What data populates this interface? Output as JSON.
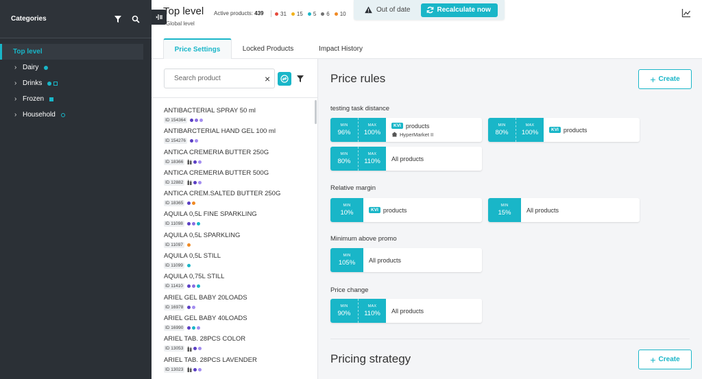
{
  "sidebar": {
    "title": "Categories",
    "items": [
      {
        "label": "Top level",
        "marker": ""
      },
      {
        "label": "Dairy",
        "marker": "dot"
      },
      {
        "label": "Drinks",
        "marker": "dot+square-outline"
      },
      {
        "label": "Frozen",
        "marker": "square"
      },
      {
        "label": "Household",
        "marker": "ring"
      }
    ]
  },
  "header": {
    "title": "Top level",
    "subtitle": "Global level",
    "active_label": "Active products:",
    "active_count": "439",
    "counts": [
      {
        "value": "31",
        "color": "#e64a3b"
      },
      {
        "value": "15",
        "color": "#f2b21b"
      },
      {
        "value": "5",
        "color": "#19b6c8"
      },
      {
        "value": "6",
        "color": "#707070"
      },
      {
        "value": "10",
        "color": "#f08a24"
      }
    ]
  },
  "banner": {
    "status": "Out of date",
    "button": "Recalculate now"
  },
  "tabs": [
    {
      "label": "Price Settings",
      "active": true
    },
    {
      "label": "Locked Products",
      "active": false
    },
    {
      "label": "Impact History",
      "active": false
    }
  ],
  "search": {
    "placeholder": "Search product",
    "value": ""
  },
  "products": [
    {
      "name": "ANTIBACTERIAL SPRAY 50 ml",
      "id": "ID 154364",
      "icons": [
        "purple",
        "violet",
        "light-violet"
      ]
    },
    {
      "name": "ANTIBARCTERIAL HAND GEL 100 ml",
      "id": "ID 154276",
      "icons": [
        "purple",
        "light-violet"
      ]
    },
    {
      "name": "ANTICA CREMERIA BUTTER 250G",
      "id": "ID 18366",
      "icons": [
        "bottle",
        "purple",
        "light-violet"
      ]
    },
    {
      "name": "ANTICA CREMERIA BUTTER 500G",
      "id": "ID 12882",
      "icons": [
        "bottle",
        "purple",
        "light-violet"
      ]
    },
    {
      "name": "ANTICA CREM.SALTED BUTTER 250G",
      "id": "ID 18365",
      "icons": [
        "purple",
        "orange"
      ]
    },
    {
      "name": "AQUILA 0,5L FINE SPARKLING",
      "id": "ID 11098",
      "icons": [
        "purple",
        "violet",
        "teal"
      ]
    },
    {
      "name": "AQUILA 0,5L SPARKLING",
      "id": "ID 11097",
      "icons": [
        "orange"
      ]
    },
    {
      "name": "AQUILA 0,5L STILL",
      "id": "ID 11099",
      "icons": [
        "teal"
      ]
    },
    {
      "name": "AQUILA 0,75L STILL",
      "id": "ID 11410",
      "icons": [
        "purple",
        "violet",
        "teal"
      ]
    },
    {
      "name": "ARIEL GEL BABY 20LOADS",
      "id": "ID 16978",
      "icons": [
        "purple",
        "light-violet"
      ]
    },
    {
      "name": "ARIEL GEL BABY 40LOADS",
      "id": "ID 16990",
      "icons": [
        "purple",
        "teal",
        "light-violet"
      ]
    },
    {
      "name": "ARIEL TAB. 28PCS COLOR",
      "id": "ID 13053",
      "icons": [
        "bottle",
        "purple",
        "light-violet"
      ]
    },
    {
      "name": "ARIEL TAB. 28PCS LAVENDER",
      "id": "ID 13023",
      "icons": [
        "bottle",
        "purple",
        "light-violet"
      ]
    }
  ],
  "main": {
    "rules_title": "Price rules",
    "create_label": "Create",
    "strategy_title": "Pricing strategy",
    "sections": [
      {
        "label": "testing task distance",
        "rules": [
          {
            "min": "96%",
            "max": "100%",
            "kvi": "KVI",
            "text": "products",
            "store": "HyperMarket II"
          },
          {
            "min": "80%",
            "max": "100%",
            "kvi": "KVI",
            "text": "products"
          },
          {
            "min": "80%",
            "max": "110%",
            "text": "All products"
          }
        ]
      },
      {
        "label": "Relative margin",
        "rules": [
          {
            "min": "10%",
            "kvi": "KVI",
            "text": "products"
          },
          {
            "min": "15%",
            "text": "All products"
          }
        ]
      },
      {
        "label": "Minimum above promo",
        "rules": [
          {
            "min": "105%",
            "text": "All products"
          }
        ]
      },
      {
        "label": "Price change",
        "rules": [
          {
            "min": "90%",
            "max": "110%",
            "text": "All products"
          }
        ]
      }
    ],
    "min_label": "MIN",
    "max_label": "MAX"
  }
}
